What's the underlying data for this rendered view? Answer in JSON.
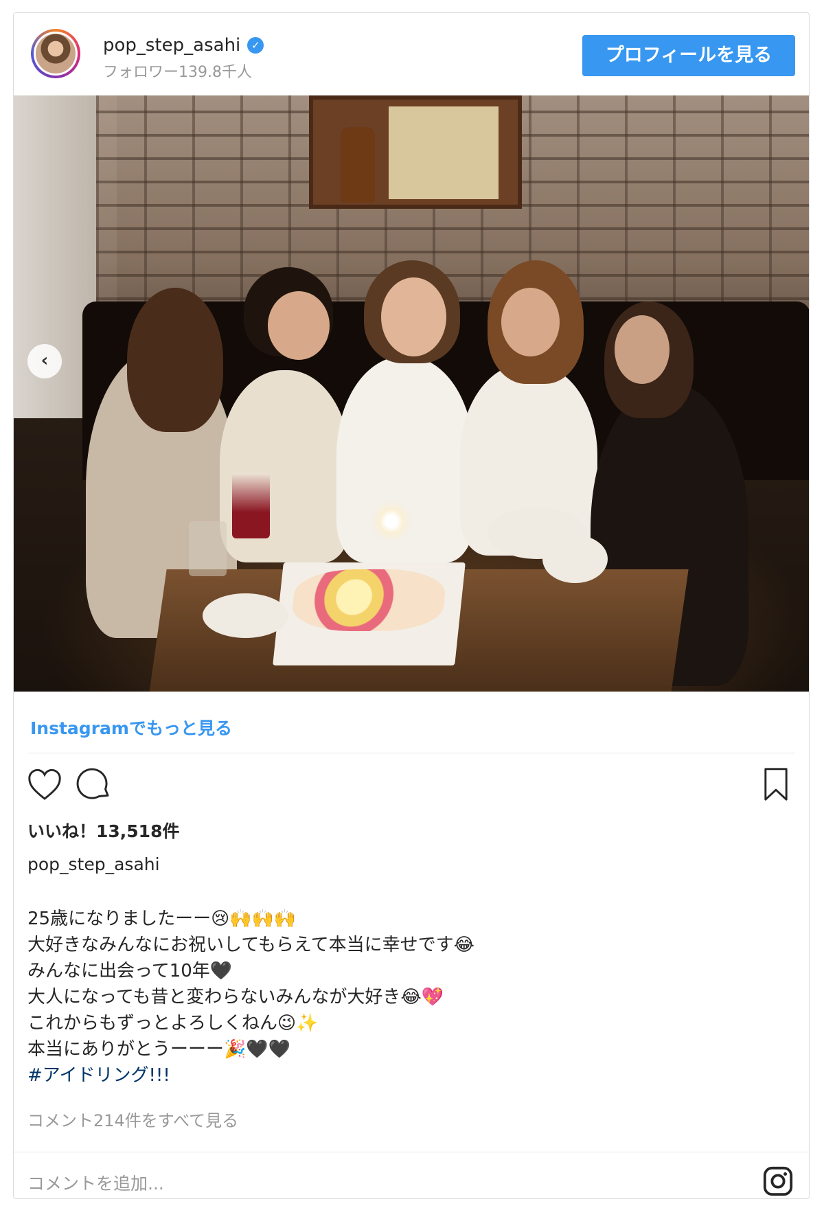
{
  "header": {
    "username": "pop_step_asahi",
    "verified_mark": "✓",
    "followers": "フォロワー139.8千人",
    "profile_button": "プロフィールを見る"
  },
  "photo": {
    "nav_prev_glyph": "‹"
  },
  "links": {
    "more_on_instagram": "Instagramでもっと見る"
  },
  "actions": {
    "like_icon": "heart-icon",
    "comment_icon": "comment-icon",
    "save_icon": "bookmark-icon"
  },
  "likes": "いいね！13,518件",
  "caption": {
    "username": "pop_step_asahi",
    "lines": [
      "25歳になりましたーー😢🙌🙌🙌",
      "大好きなみんなにお祝いしてもらえて本当に幸せです😂",
      "みんなに出会って10年🖤",
      "大人になっても昔と変わらないみんなが大好き😂💖",
      "これからもずっとよろしくねん😉✨",
      "本当にありがとうーーー🎉🖤🖤"
    ],
    "hashtag": "#アイドリング!!!"
  },
  "view_comments": "コメント214件をすべて見る",
  "add_comment_placeholder": "コメントを追加...",
  "colors": {
    "accent": "#3897f0",
    "hashtag": "#003569",
    "muted": "#999999",
    "text": "#262626"
  }
}
